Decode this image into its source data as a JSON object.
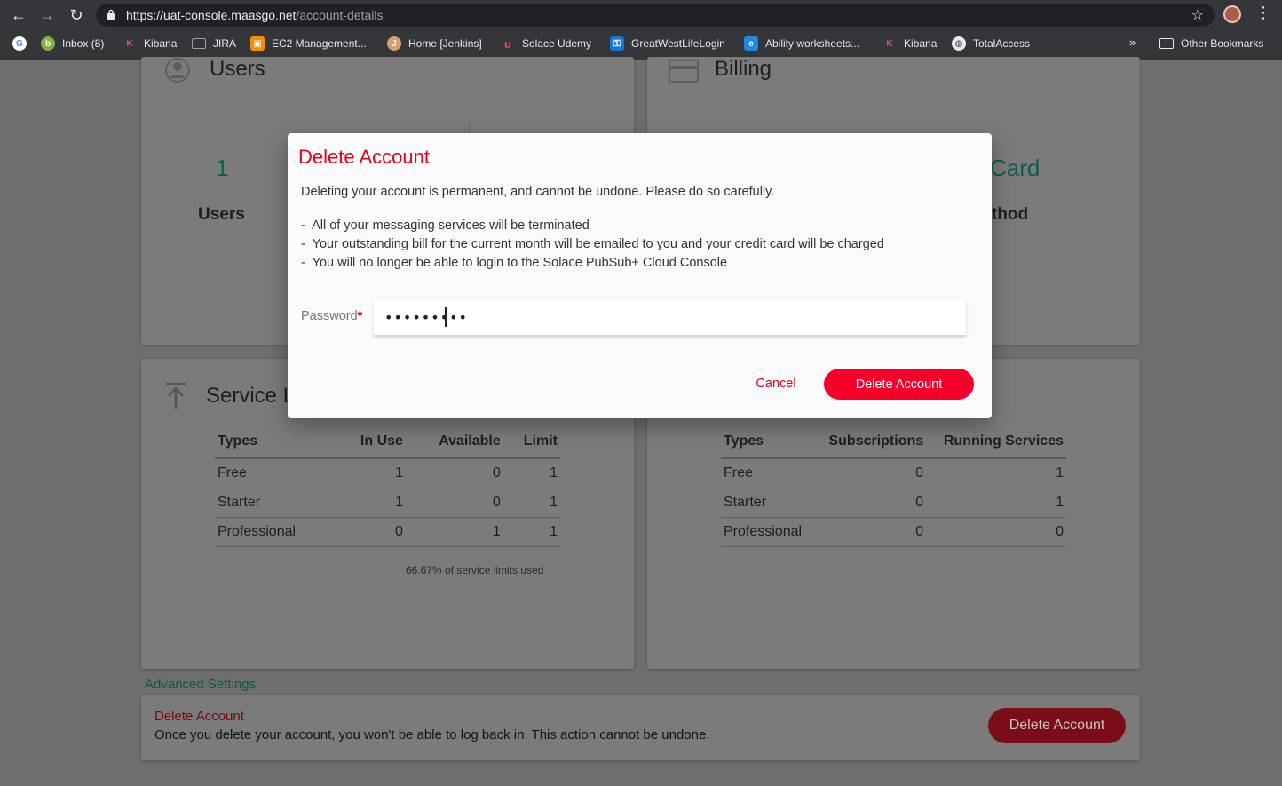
{
  "browser": {
    "url_host": "https://uat-console.maasgo.net",
    "url_path": "/account-details",
    "bookmarks": [
      {
        "label": "Inbox (8)",
        "icon": "inbox-icon",
        "color": "#7cb342"
      },
      {
        "label": "Kibana",
        "icon": "kibana-icon",
        "color": "#e8478b"
      },
      {
        "label": "JIRA",
        "icon": "folder-icon",
        "color": "#9aa0a6"
      },
      {
        "label": "EC2 Management...",
        "icon": "aws-icon",
        "color": "#f29100"
      },
      {
        "label": "Home [Jenkins]",
        "icon": "jenkins-icon",
        "color": "#d9a16a"
      },
      {
        "label": "Solace Udemy",
        "icon": "udemy-icon",
        "color": "#ec5252"
      },
      {
        "label": "GreatWestLifeLogin",
        "icon": "key-icon",
        "color": "#1976d2"
      },
      {
        "label": "Ability worksheets...",
        "icon": "document-icon",
        "color": "#1e88e5"
      },
      {
        "label": "Kibana",
        "icon": "kibana-icon",
        "color": "#e8478b"
      },
      {
        "label": "TotalAccess",
        "icon": "globe-icon",
        "color": "#e8eaed"
      }
    ],
    "overflow": "»",
    "other_bookmarks": "Other Bookmarks"
  },
  "users_card": {
    "title": "Users",
    "count": "1",
    "count_label": "Users"
  },
  "billing_card": {
    "title": "Billing",
    "partial_value": "Card",
    "partial_label": "thod"
  },
  "service_card": {
    "title": "Service L",
    "headers": [
      "Types",
      "In Use",
      "Available",
      "Limit"
    ],
    "rows": [
      [
        "Free",
        "1",
        "0",
        "1"
      ],
      [
        "Starter",
        "1",
        "0",
        "1"
      ],
      [
        "Professional",
        "0",
        "1",
        "1"
      ]
    ],
    "usage": "66.67% of service limits used"
  },
  "subscription_card": {
    "headers": [
      "Types",
      "Subscriptions",
      "Running Services"
    ],
    "rows": [
      [
        "Free",
        "0",
        "1"
      ],
      [
        "Starter",
        "0",
        "1"
      ],
      [
        "Professional",
        "0",
        "0"
      ]
    ]
  },
  "advanced": {
    "link": "Advanced Settings",
    "delete_title": "Delete Account",
    "delete_desc": "Once you delete your account, you won't be able to log back in. This action cannot be undone.",
    "delete_button": "Delete Account"
  },
  "modal": {
    "title": "Delete Account",
    "text": "Deleting your account is permanent, and cannot be undone. Please do so carefully.",
    "consequences": [
      "All of your messaging services will be terminated",
      "Your outstanding bill for the current month will be emailed to you and your credit card will be charged",
      "You will no longer be able to login to the Solace PubSub+ Cloud Console"
    ],
    "password_label": "Password",
    "password_required_mark": "*",
    "password_value": "•••••••••",
    "cancel": "Cancel",
    "confirm": "Delete Account",
    "accent": "#e4001b"
  }
}
